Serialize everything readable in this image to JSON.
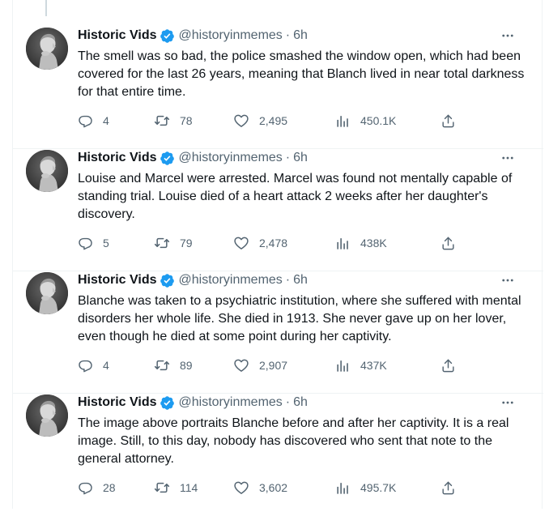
{
  "author": {
    "name": "Historic Vids",
    "handle": "@historyinmemes",
    "separator": "·",
    "verified_color": "#1d9bf0"
  },
  "colors": {
    "text": "#0f1419",
    "secondary": "#536471",
    "divider": "#eff3f4"
  },
  "icons": [
    "more-icon",
    "verified-badge-icon",
    "reply-icon",
    "retweet-icon",
    "like-icon",
    "views-icon",
    "share-icon"
  ],
  "tweets": [
    {
      "time": "6h",
      "text": "The smell was so bad, the police smashed the window open, which had been covered for the last 26 years, meaning that Blanch lived in near total darkness for that entire time.",
      "replies": "4",
      "retweets": "78",
      "likes": "2,495",
      "views": "450.1K"
    },
    {
      "time": "6h",
      "text": "Louise and Marcel were arrested. Marcel was found not mentally capable of standing trial. Louise died of a heart attack 2 weeks after her daughter's discovery.",
      "replies": "5",
      "retweets": "79",
      "likes": "2,478",
      "views": "438K"
    },
    {
      "time": "6h",
      "text": "Blanche was taken to a psychiatric institution, where she suffered with mental disorders her whole life. She died in 1913. She never gave up on her lover, even though he died at some point during her captivity.",
      "replies": "4",
      "retweets": "89",
      "likes": "2,907",
      "views": "437K"
    },
    {
      "time": "6h",
      "text": "The image above portraits Blanche before and after her captivity. It is a real image. Still, to this day, nobody has discovered who sent that note to the general attorney.",
      "replies": "28",
      "retweets": "114",
      "likes": "3,602",
      "views": "495.7K"
    }
  ]
}
